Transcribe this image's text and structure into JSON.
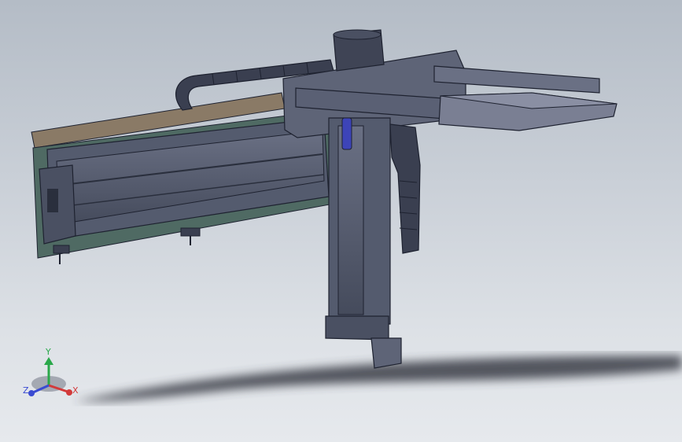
{
  "viewport": {
    "background_top": "#b4bcc6",
    "background_bottom": "#e6e9ed"
  },
  "model": {
    "body_color": "#545b6e",
    "edge_color": "#1e2230",
    "plate_color": "#7a7f93",
    "wood_color": "#8a7a66",
    "green_plate_color": "#4f6a63",
    "accent_color": "#3d44b8"
  },
  "triad": {
    "y_label": "Y",
    "x_label": "X",
    "z_label": "Z",
    "y_color": "#2aa84a",
    "x_color": "#d23a3a",
    "z_color": "#3a4bd2"
  }
}
